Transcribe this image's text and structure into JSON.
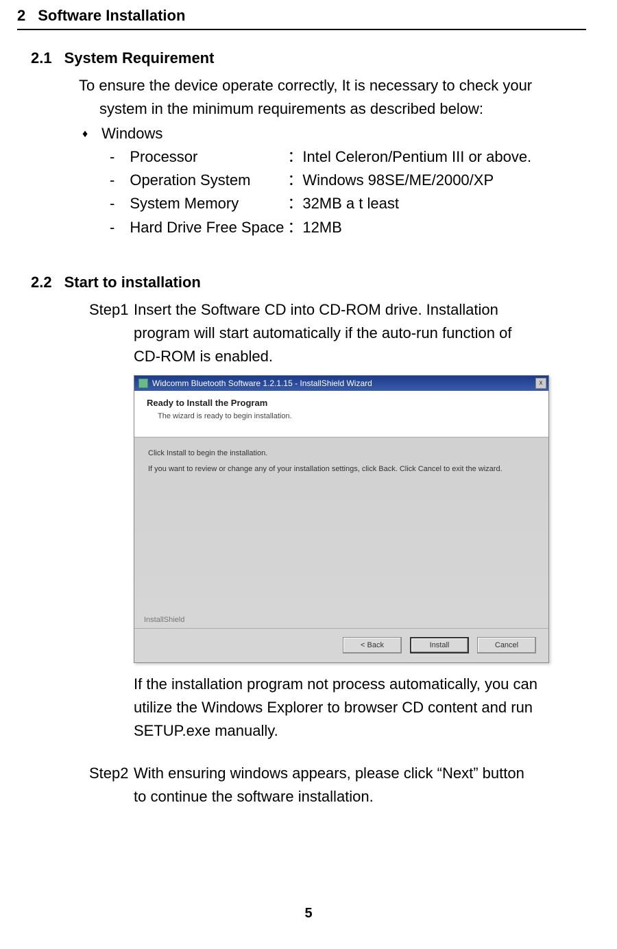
{
  "h1": {
    "num": "2",
    "title": "Software Installation"
  },
  "s21": {
    "num": "2.1",
    "title": "System Requirement",
    "intro1": "To ensure the device operate correctly, It is necessary to check your",
    "intro2": "system in the minimum requirements as described below:",
    "bullet": "Windows",
    "rows": [
      {
        "label": "Processor",
        "value": "：Intel Celeron/Pentium III or above."
      },
      {
        "label": "Operation System",
        "value": "：Windows 98SE/ME/2000/XP"
      },
      {
        "label": "System Memory",
        "value": "：32MB a t least"
      },
      {
        "label": "Hard Drive Free Space",
        "value": "：12MB"
      }
    ]
  },
  "s22": {
    "num": "2.2",
    "title": "Start to installation",
    "step1": {
      "label": "Step1",
      "l1": "Insert the Software CD into CD-ROM drive. Installation",
      "l2": "program will start automatically if the auto-run function of",
      "l3": "CD-ROM is enabled."
    },
    "after1": "If the installation program not process automatically, you can",
    "after2": "utilize the Windows Explorer to browser CD content and run",
    "after3": "SETUP.exe manually.",
    "step2": {
      "label": "Step2",
      "l1": "With ensuring windows appears, please click “Next” button",
      "l2": "to continue the software installation."
    }
  },
  "wizard": {
    "title": "Widcomm Bluetooth Software 1.2.1.15 - InstallShield Wizard",
    "close": "x",
    "headTitle": "Ready to Install the Program",
    "headSub": "The wizard is ready to begin installation.",
    "body1": "Click Install to begin the installation.",
    "body2": "If you want to review or change any of your installation settings, click Back. Click Cancel to exit the wizard.",
    "status": "InstallShield",
    "back": "< Back",
    "install": "Install",
    "cancel": "Cancel"
  },
  "pageNum": "5"
}
